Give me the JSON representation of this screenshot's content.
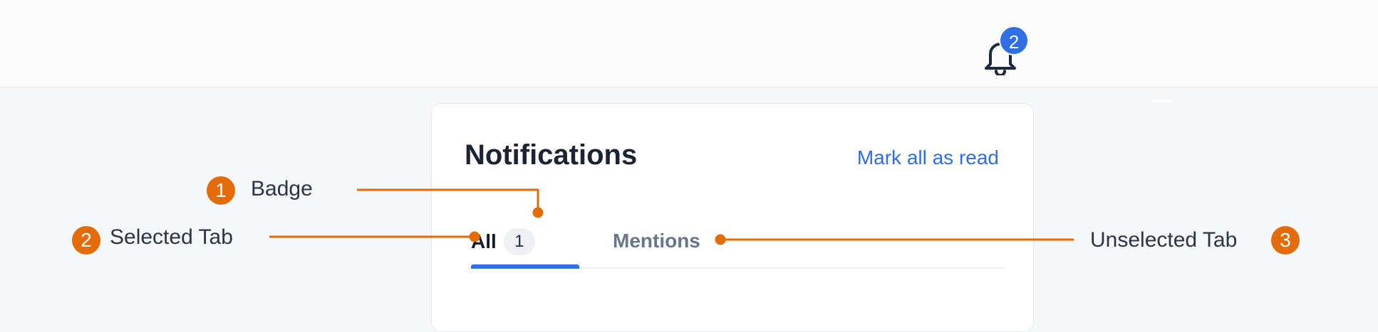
{
  "header": {
    "notification_count": "2",
    "bell_icon": "bell-icon"
  },
  "panel": {
    "title": "Notifications",
    "mark_all_read": "Mark all as read",
    "tabs": [
      {
        "label": "All",
        "count": "1",
        "selected": true
      },
      {
        "label": "Mentions",
        "selected": false
      }
    ]
  },
  "annotations": [
    {
      "number": "1",
      "label": "Badge"
    },
    {
      "number": "2",
      "label": "Selected Tab"
    },
    {
      "number": "3",
      "label": "Unselected Tab"
    }
  ],
  "colors": {
    "accent": "#2f6fe4",
    "callout": "#e36c0a",
    "background": "#f6f7f9"
  }
}
